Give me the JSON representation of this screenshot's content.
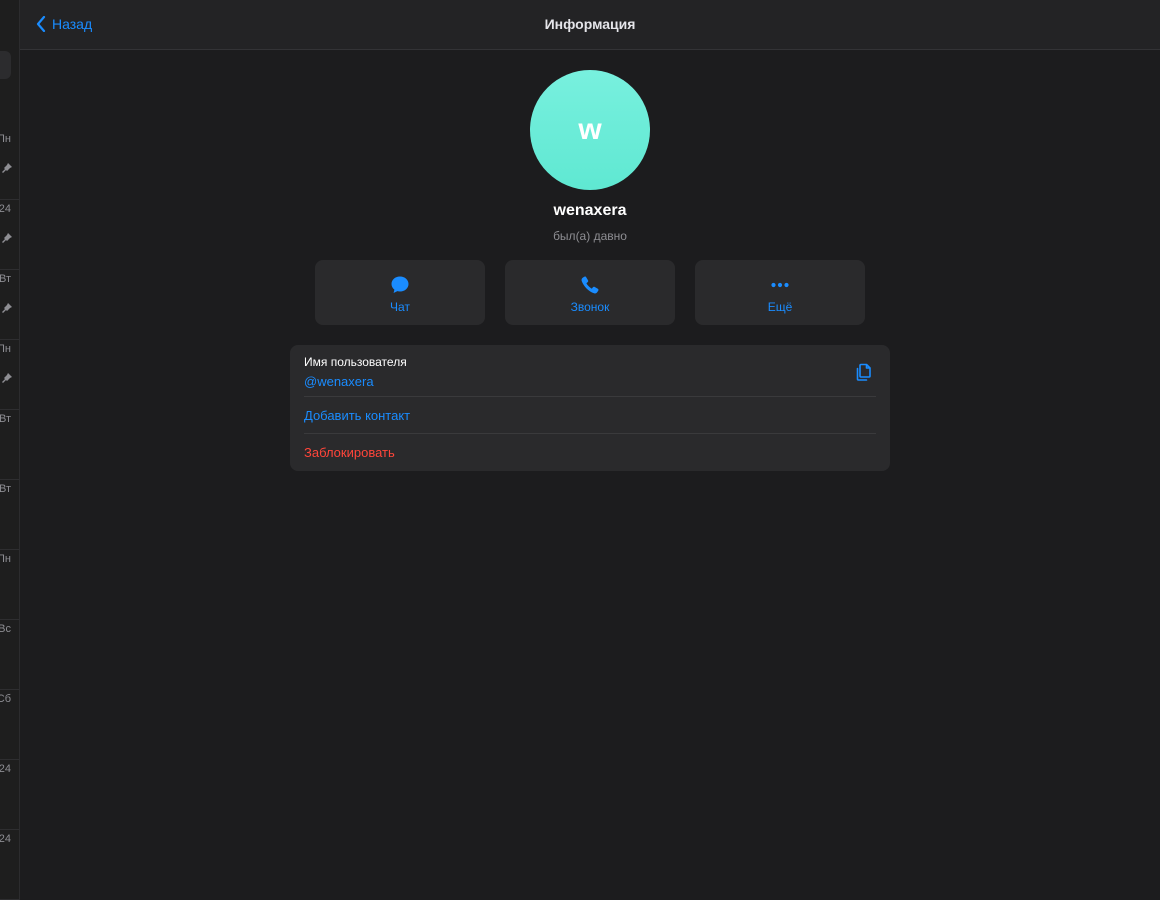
{
  "header": {
    "back_label": "Назад",
    "title": "Информация"
  },
  "profile": {
    "avatar_letter": "w",
    "name": "wenaxera",
    "status": "был(а) давно",
    "avatar_color": "#6ff0da"
  },
  "actions": [
    {
      "label": "Чат",
      "icon": "chat-bubble-icon"
    },
    {
      "label": "Звонок",
      "icon": "phone-icon"
    },
    {
      "label": "Ещё",
      "icon": "more-dots-icon"
    }
  ],
  "info": {
    "username_label": "Имя пользователя",
    "username_value": "@wenaxera",
    "add_contact": "Добавить контакт",
    "block": "Заблокировать"
  },
  "sidebar": {
    "times": [
      "Пн",
      "24",
      "Вт",
      "Пн",
      "Вт",
      "Вт",
      "Пн",
      "Вс",
      "Сб",
      "24",
      "24"
    ]
  },
  "colors": {
    "accent": "#1a8cff",
    "danger": "#ff453a",
    "background": "#1c1c1e",
    "surface": "#2a2a2c"
  }
}
